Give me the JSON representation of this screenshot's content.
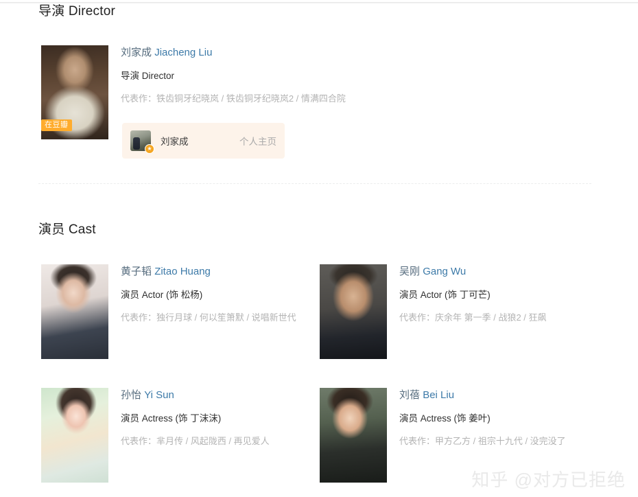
{
  "sections": {
    "director": {
      "title": "导演 Director",
      "person": {
        "name_cn": "刘家成",
        "name_en": "Jiacheng Liu",
        "role": "导演 Director",
        "works": "代表作：铁齿铜牙纪晓岚 / 铁齿铜牙纪晓岚2 / 情满四合院",
        "badge": "在豆瓣"
      },
      "profile_card": {
        "name": "刘家成",
        "link_label": "个人主页",
        "star_glyph": "★"
      }
    },
    "cast": {
      "title": "演员 Cast",
      "members": [
        {
          "name_cn": "黄子韬",
          "name_en": "Zitao Huang",
          "role": "演员 Actor (饰 松杨)",
          "works": "代表作：独行月球 / 何以笙箫默 / 说唱新世代"
        },
        {
          "name_cn": "吴刚",
          "name_en": "Gang Wu",
          "role": "演员 Actor (饰 丁可芒)",
          "works": "代表作：庆余年 第一季 / 战狼2 / 狂飙"
        },
        {
          "name_cn": "孙怡",
          "name_en": "Yi Sun",
          "role": "演员 Actress (饰 丁沫沫)",
          "works": "代表作：芈月传 / 风起陇西 / 再见爱人"
        },
        {
          "name_cn": "刘蓓",
          "name_en": "Bei Liu",
          "role": "演员 Actress (饰 姜叶)",
          "works": "代表作：甲方乙方 / 祖宗十九代 / 没完没了"
        }
      ]
    }
  },
  "watermark": "知乎 @对方已拒绝",
  "colors": {
    "link": "#3d7aa8",
    "badge_orange": "#ffac2d",
    "card_bg": "#fdf3ea",
    "muted_text": "#b3b3b3"
  }
}
